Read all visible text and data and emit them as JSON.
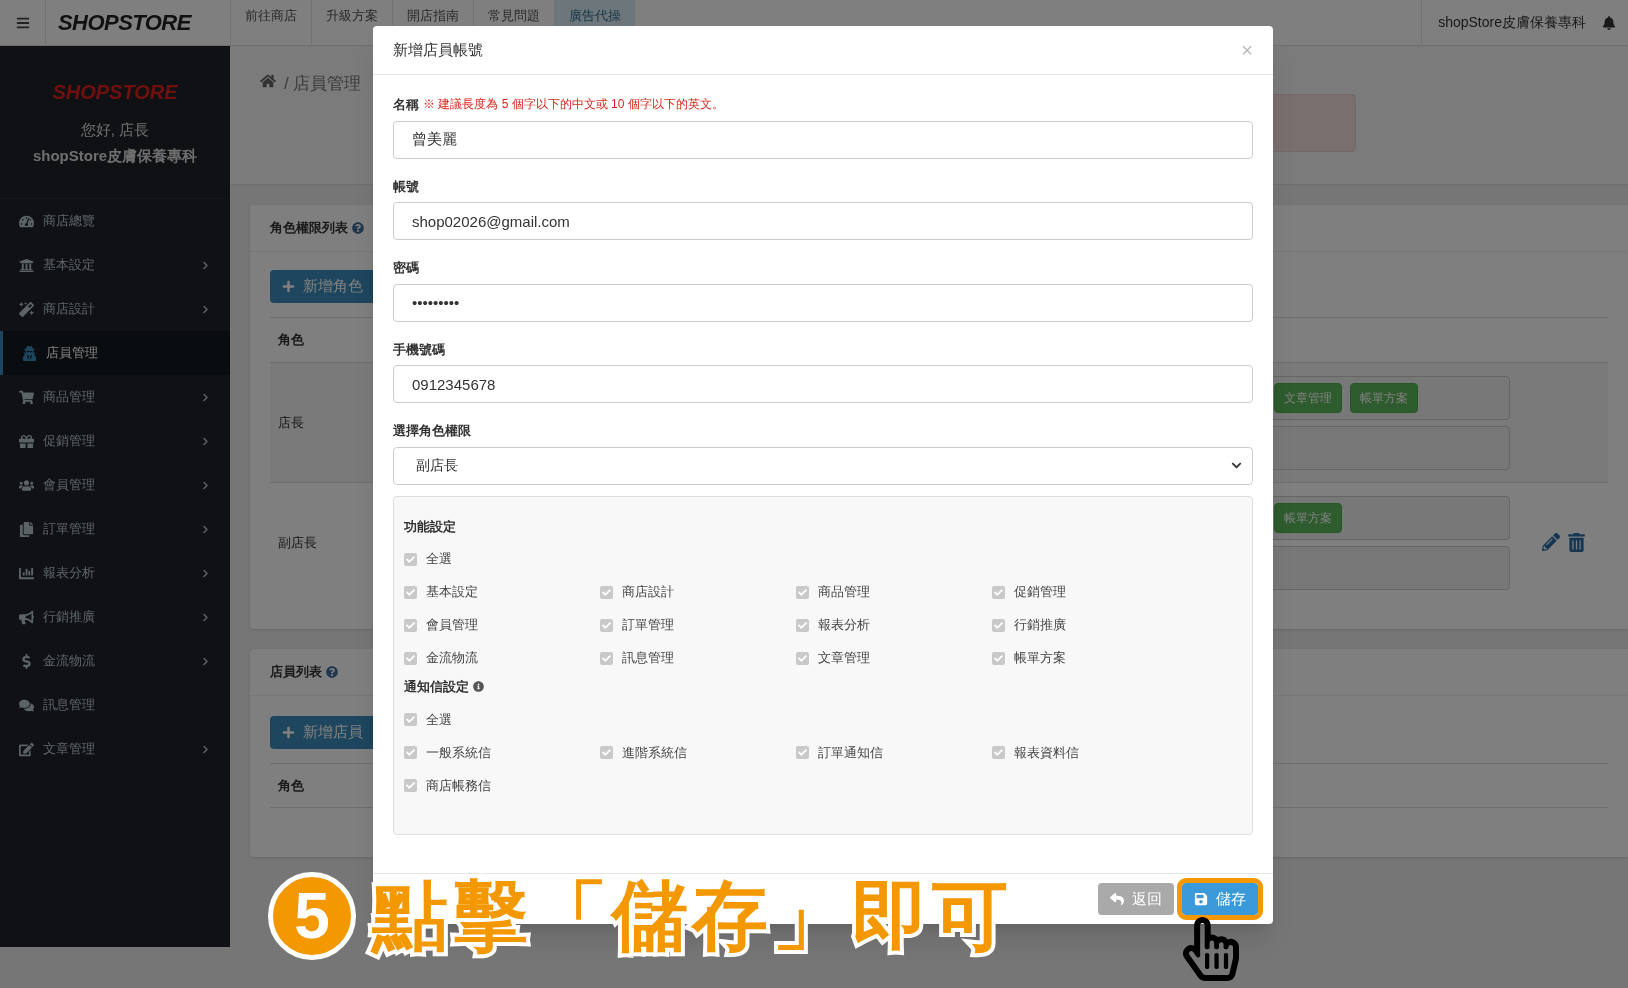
{
  "top_bar": {
    "logo": "SHOPSTORE",
    "nav": [
      {
        "label": "前往商店",
        "selected": false
      },
      {
        "label": "升級方案",
        "selected": false
      },
      {
        "label": "開店指南",
        "selected": false
      },
      {
        "label": "常見問題",
        "selected": false
      },
      {
        "label": "廣告代操",
        "selected": true
      }
    ],
    "store_name": "shopStore皮膚保養專科"
  },
  "sidebar": {
    "logo": "SHOPSTORE",
    "greeting": "您好, 店長",
    "store_name": "shopStore皮膚保養專科",
    "items": [
      {
        "label": "商店總覽",
        "selected": false,
        "has_children": false
      },
      {
        "label": "基本設定",
        "selected": false,
        "has_children": true
      },
      {
        "label": "商店設計",
        "selected": false,
        "has_children": true
      },
      {
        "label": "店員管理",
        "selected": true,
        "has_children": false
      },
      {
        "label": "商品管理",
        "selected": false,
        "has_children": true
      },
      {
        "label": "促銷管理",
        "selected": false,
        "has_children": true
      },
      {
        "label": "會員管理",
        "selected": false,
        "has_children": true
      },
      {
        "label": "訂單管理",
        "selected": false,
        "has_children": true
      },
      {
        "label": "報表分析",
        "selected": false,
        "has_children": true
      },
      {
        "label": "行銷推廣",
        "selected": false,
        "has_children": true
      },
      {
        "label": "金流物流",
        "selected": false,
        "has_children": true
      },
      {
        "label": "訊息管理",
        "selected": false,
        "has_children": false
      },
      {
        "label": "文章管理",
        "selected": false,
        "has_children": true
      }
    ]
  },
  "breadcrumb": "/ 店員管理",
  "role_card": {
    "title": "角色權限列表",
    "add_button": "新增角色",
    "column": "角色",
    "rows": [
      {
        "role": "店長",
        "badges": [
          "文章管理",
          "帳單方案"
        ],
        "actions": false
      },
      {
        "role": "副店長",
        "badges": [
          "帳單方案"
        ],
        "actions": true
      }
    ]
  },
  "staff_card": {
    "title": "店員列表",
    "add_button": "新增店員",
    "column": "角色"
  },
  "modal": {
    "title": "新增店員帳號",
    "close": "×",
    "fields": [
      {
        "kind": "text",
        "label": "名稱",
        "note": "※ 建議長度為 5 個字以下的中文或 10 個字以下的英文。",
        "value": "曾美麗"
      },
      {
        "kind": "text",
        "label": "帳號",
        "value": "shop02026@gmail.com"
      },
      {
        "kind": "text",
        "label": "密碼",
        "value": "•••••••••"
      },
      {
        "kind": "text",
        "label": "手機號碼",
        "value": "0912345678"
      },
      {
        "kind": "select",
        "label": "選擇角色權限",
        "value": "副店長"
      }
    ],
    "sections": [
      {
        "title": "功能設定",
        "info": false,
        "select_all": {
          "label": "全選",
          "checked": true
        },
        "items": [
          {
            "label": "基本設定",
            "checked": true
          },
          {
            "label": "商店設計",
            "checked": true
          },
          {
            "label": "商品管理",
            "checked": true
          },
          {
            "label": "促銷管理",
            "checked": true
          },
          {
            "label": "會員管理",
            "checked": true
          },
          {
            "label": "訂單管理",
            "checked": true
          },
          {
            "label": "報表分析",
            "checked": true
          },
          {
            "label": "行銷推廣",
            "checked": true
          },
          {
            "label": "金流物流",
            "checked": true
          },
          {
            "label": "訊息管理",
            "checked": true
          },
          {
            "label": "文章管理",
            "checked": true
          },
          {
            "label": "帳單方案",
            "checked": true
          }
        ]
      },
      {
        "title": "通知信設定",
        "info": true,
        "select_all": {
          "label": "全選",
          "checked": true
        },
        "items": [
          {
            "label": "一般系統信",
            "checked": true
          },
          {
            "label": "進階系統信",
            "checked": true
          },
          {
            "label": "訂單通知信",
            "checked": true
          },
          {
            "label": "報表資料信",
            "checked": true
          },
          {
            "label": "商店帳務信",
            "checked": true
          }
        ]
      }
    ],
    "buttons": [
      {
        "kind": "back",
        "label": "返回",
        "disabled": true,
        "highlighted": false
      },
      {
        "kind": "save",
        "label": "儲存",
        "disabled": false,
        "highlighted": true
      }
    ]
  },
  "annotation": {
    "step": "5",
    "text": "點擊「儲存」即可"
  }
}
